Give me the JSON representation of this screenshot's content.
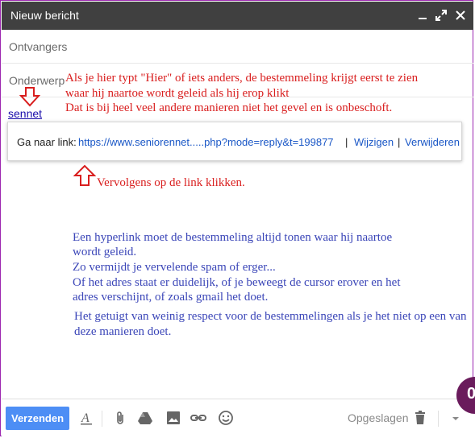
{
  "window": {
    "title": "Nieuw bericht"
  },
  "fields": {
    "to_placeholder": "Ontvangers",
    "subject_placeholder": "Onderwerp"
  },
  "body": {
    "link_text": "sennet",
    "notes_red": [
      "Als je hier typt \"Hier\" of iets anders, de bestemmeling krijgt eerst te zien",
      "waar hij naartoe wordt geleid als hij erop klikt",
      "Dat is bij heel veel andere manieren niet het gevel en is onbeschoft.",
      "Vervolgens op de link klikken."
    ],
    "notes_blue": [
      "Een hyperlink moet de bestemmeling altijd tonen waar hij naartoe",
      "wordt geleid.",
      "Zo vermijdt je vervelende spam of erger...",
      "Of het adres staat er duidelijk, of je beweegt de cursor erover en het",
      "adres verschijnt, of zoals gmail het doet.",
      "Het getuigt van weinig respect voor de bestemmelingen als je het niet op een van",
      "deze manieren doet."
    ]
  },
  "link_popup": {
    "label": "Ga naar link:",
    "url": "https://www.seniorennet.....php?mode=reply&t=199877",
    "separator": "|",
    "change": "Wijzigen",
    "remove": "Verwijderen"
  },
  "toolbar": {
    "send_label": "Verzenden",
    "saved_label": "Opgeslagen"
  },
  "badge": {
    "letter": "0"
  },
  "colors": {
    "titlebar": "#404040",
    "send": "#4d8ef5",
    "annotation_red": "#d91e1e",
    "annotation_blue": "#3b46b8",
    "link": "#1a57c6"
  },
  "icons": [
    "minimize-icon",
    "expand-icon",
    "close-icon",
    "formatting-icon",
    "attach-icon",
    "drive-icon",
    "photo-icon",
    "link-icon",
    "emoji-icon",
    "trash-icon",
    "more-options-icon"
  ]
}
